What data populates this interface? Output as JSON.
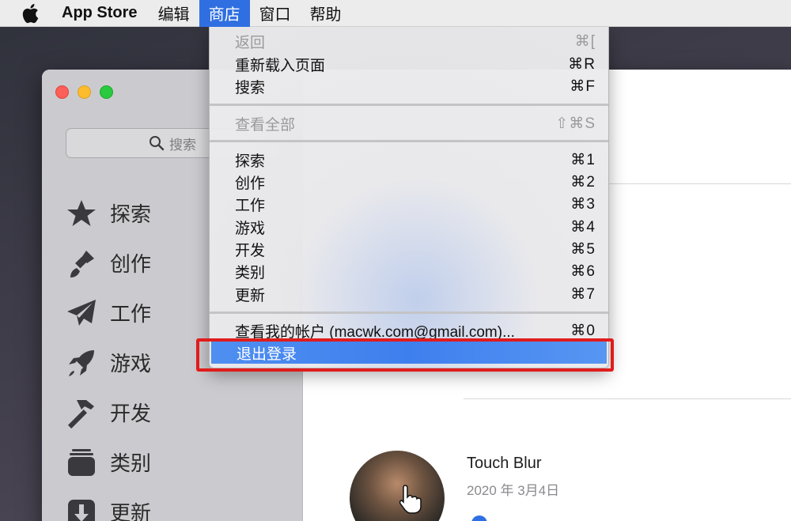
{
  "menubar": {
    "apple_icon": "apple-logo-icon",
    "app_name": "App Store",
    "items": [
      "编辑",
      "商店",
      "窗口",
      "帮助"
    ],
    "active_item": "商店",
    "accent_color": "#2f6fe1"
  },
  "window": {
    "search_placeholder": "搜索",
    "sidebar": [
      {
        "label": "探索",
        "icon": "star-icon"
      },
      {
        "label": "创作",
        "icon": "paintbrush-icon"
      },
      {
        "label": "工作",
        "icon": "paper-plane-icon"
      },
      {
        "label": "游戏",
        "icon": "rocket-icon"
      },
      {
        "label": "开发",
        "icon": "hammer-icon"
      },
      {
        "label": "类别",
        "icon": "stack-icon"
      },
      {
        "label": "更新",
        "icon": "download-icon"
      }
    ],
    "card": {
      "title": "Touch Blur",
      "date": "2020 年 3月4日"
    }
  },
  "store_menu": {
    "items": [
      {
        "label": "返回",
        "shortcut": "⌘[",
        "disabled": true
      },
      {
        "label": "重新载入页面",
        "shortcut": "⌘R",
        "disabled": false
      },
      {
        "label": "搜索",
        "shortcut": "⌘F",
        "disabled": false
      },
      {
        "label": "查看全部",
        "shortcut": "⇧⌘S",
        "disabled": true
      },
      {
        "label": "探索",
        "shortcut": "⌘1",
        "disabled": false
      },
      {
        "label": "创作",
        "shortcut": "⌘2",
        "disabled": false
      },
      {
        "label": "工作",
        "shortcut": "⌘3",
        "disabled": false
      },
      {
        "label": "游戏",
        "shortcut": "⌘4",
        "disabled": false
      },
      {
        "label": "开发",
        "shortcut": "⌘5",
        "disabled": false
      },
      {
        "label": "类别",
        "shortcut": "⌘6",
        "disabled": false
      },
      {
        "label": "更新",
        "shortcut": "⌘7",
        "disabled": false
      },
      {
        "label": "查看我的帐户 (macwk.com@gmail.com)...",
        "shortcut": "⌘0",
        "disabled": false
      },
      {
        "label": "退出登录",
        "shortcut": "",
        "disabled": false,
        "selected": true
      }
    ],
    "highlight_color": "#e11c1c"
  }
}
